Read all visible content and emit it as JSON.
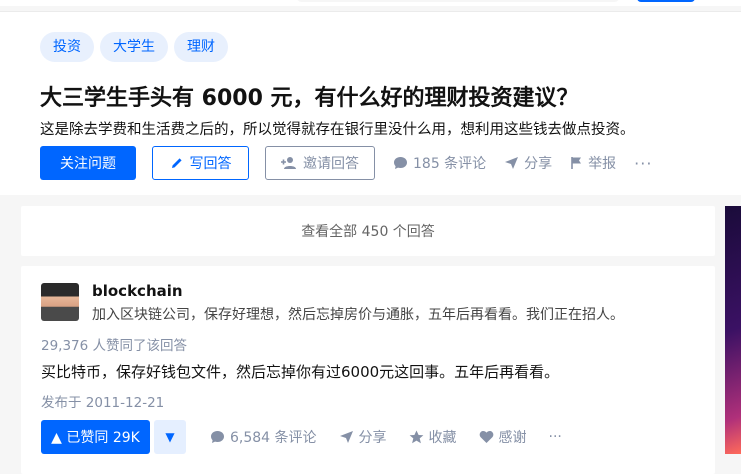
{
  "question": {
    "tags": [
      "投资",
      "大学生",
      "理财"
    ],
    "title": "大三学生手头有 6000 元，有什么好的理财投资建议？",
    "detail": "这是除去学费和生活费之后的，所以觉得就存在银行里没什么用，想利用这些钱去做点投资。",
    "actions": {
      "follow": "关注问题",
      "write": "写回答",
      "invite": "邀请回答",
      "comments": "185 条评论",
      "share": "分享",
      "report": "举报",
      "more": "···"
    }
  },
  "view_all": "查看全部 450 个回答",
  "answer": {
    "author": {
      "name": "blockchain",
      "bio": "加入区块链公司，保存好理想，然后忘掉房价与通胀，五年后再看看。我们正在招人。"
    },
    "votes_text": "29,376 人赞同了该回答",
    "content": "买比特币，保存好钱包文件，然后忘掉你有过6000元这回事。五年后再看看。",
    "published": "发布于 2011-12-21",
    "actions": {
      "upvote": "▲ 已赞同 29K",
      "downvote": "▼",
      "comments": "6,584 条评论",
      "share": "分享",
      "collect": "收藏",
      "thanks": "感谢",
      "more": "···"
    }
  },
  "colors": {
    "brand": "#0066ff",
    "muted": "#8590a6",
    "tag_bg": "#e8f0fd"
  }
}
